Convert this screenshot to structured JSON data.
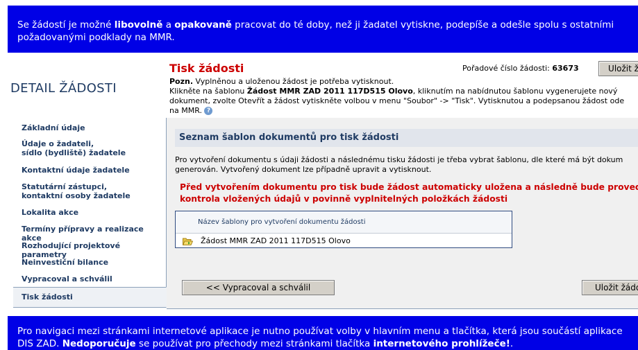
{
  "top_banner": {
    "part1": "Se žádostí je možné ",
    "bold1": "libovolně",
    "part2": " a ",
    "bold2": "opakovaně",
    "part3": " pracovat do té doby, než ji žadatel vytiskne, podepíše a odešle spolu s ostatními",
    "line2": "požadovanými podklady na MMR."
  },
  "page_title": "DETAIL ŽÁDOSTI",
  "section_title": "Tisk žádosti",
  "order": {
    "label": "Pořadové číslo žádosti:",
    "value": "63673"
  },
  "save_top_label": "Uložit ž",
  "note": {
    "label": "Pozn.",
    "line1": " Vyplněnou a uloženou žádost je potřeba vytisknout.",
    "line2a": "Klikněte na šablonu ",
    "line2b": "Žádost MMR ZAD 2011 117D515 Olovo",
    "line2c": ", kliknutím na nabídnutou šablonu vygenerujete nový",
    "line3": "dokument, zvolte Otevřít a žádost vytiskněte volbou v menu \"Soubor\" -> \"Tisk\". Vytisknutou a podepsanou žádost ode",
    "line4": "na MMR."
  },
  "sidebar": {
    "items": [
      {
        "label": "Základní údaje"
      },
      {
        "label1": "Údaje o žadateli,",
        "label2": "sídlo (bydliště) žadatele"
      },
      {
        "label": "Kontaktní údaje žadatele"
      },
      {
        "label1": "Statutární zástupci,",
        "label2": "kontaktní osoby žadatele"
      },
      {
        "label": "Lokalita akce"
      },
      {
        "label": "Termíny přípravy a realizace akce"
      },
      {
        "label": "Rozhodující projektové parametry"
      },
      {
        "label": "Neinvestiční bilance"
      },
      {
        "label": "Vypracoval a schválil"
      },
      {
        "label": "Tisk žádosti"
      }
    ]
  },
  "panel": {
    "title": "Seznam šablon dokumentů pro tisk žádosti",
    "desc1": "Pro vytvoření dokumentu s údaji žádosti a následnému tisku žádosti je třeba vybrat šablonu, dle které má být dokum",
    "desc2": "generován. Vytvořený dokument lze případně upravit a vytisknout.",
    "warn1": "Před vytvořením dokumentu pro tisk bude žádost automaticky uložena a následně bude provedená závě",
    "warn2": "kontrola vložených údajů v povinně vyplnitelných položkách žádosti",
    "table_header": "Název šablony pro vytvoření dokumentu žádosti",
    "template_name": "Žádost MMR ZAD 2011 117D515 Olovo",
    "back_button": "<<  Vypracoval a schválil",
    "save_button": "Uložit žádo"
  },
  "bottom_banner": {
    "line1": "Pro navigaci mezi stránkami internetové aplikace je nutno používat volby v hlavním menu a tlačítka, která jsou součástí aplikace",
    "part2a": "DIS ZAD. ",
    "bold2": "Nedoporučuje",
    "part2b": " se používat pro přechody mezi stránkami tlačítka ",
    "bold3": "internetového prohlížeče!",
    "part2c": "."
  },
  "colors": {
    "banner": "#0000e6",
    "title_red": "#cc0000",
    "nav_text": "#1f3b63"
  },
  "icons": [
    "help-icon",
    "folder-icon"
  ]
}
